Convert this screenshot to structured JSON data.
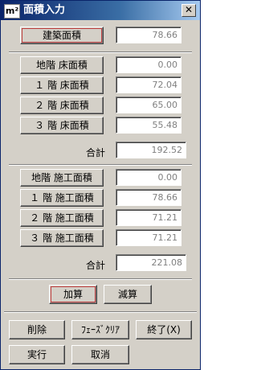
{
  "window": {
    "title": "面積入力",
    "icon_text": "m²",
    "close_label": "✕"
  },
  "building_area": {
    "button": "建築面積",
    "value": "78.66"
  },
  "floor_area": {
    "rows": [
      {
        "label": "地階 床面積",
        "value": "0.00"
      },
      {
        "label": "１ 階 床面積",
        "value": "72.04"
      },
      {
        "label": "２ 階 床面積",
        "value": "65.00"
      },
      {
        "label": "３ 階 床面積",
        "value": "55.48"
      }
    ],
    "total_label": "合計",
    "total_value": "192.52"
  },
  "construction_area": {
    "rows": [
      {
        "label": "地階 施工面積",
        "value": "0.00"
      },
      {
        "label": "１ 階 施工面積",
        "value": "78.66"
      },
      {
        "label": "２ 階 施工面積",
        "value": "71.21"
      },
      {
        "label": "３ 階 施工面積",
        "value": "71.21"
      }
    ],
    "total_label": "合計",
    "total_value": "221.08"
  },
  "ops": {
    "add": "加算",
    "subtract": "減算"
  },
  "footer": {
    "delete": "削除",
    "phase_clear": "ﾌｪｰｽﾞｸﾘｱ",
    "exit": "終了(X)",
    "execute": "実行",
    "cancel": "取消"
  }
}
